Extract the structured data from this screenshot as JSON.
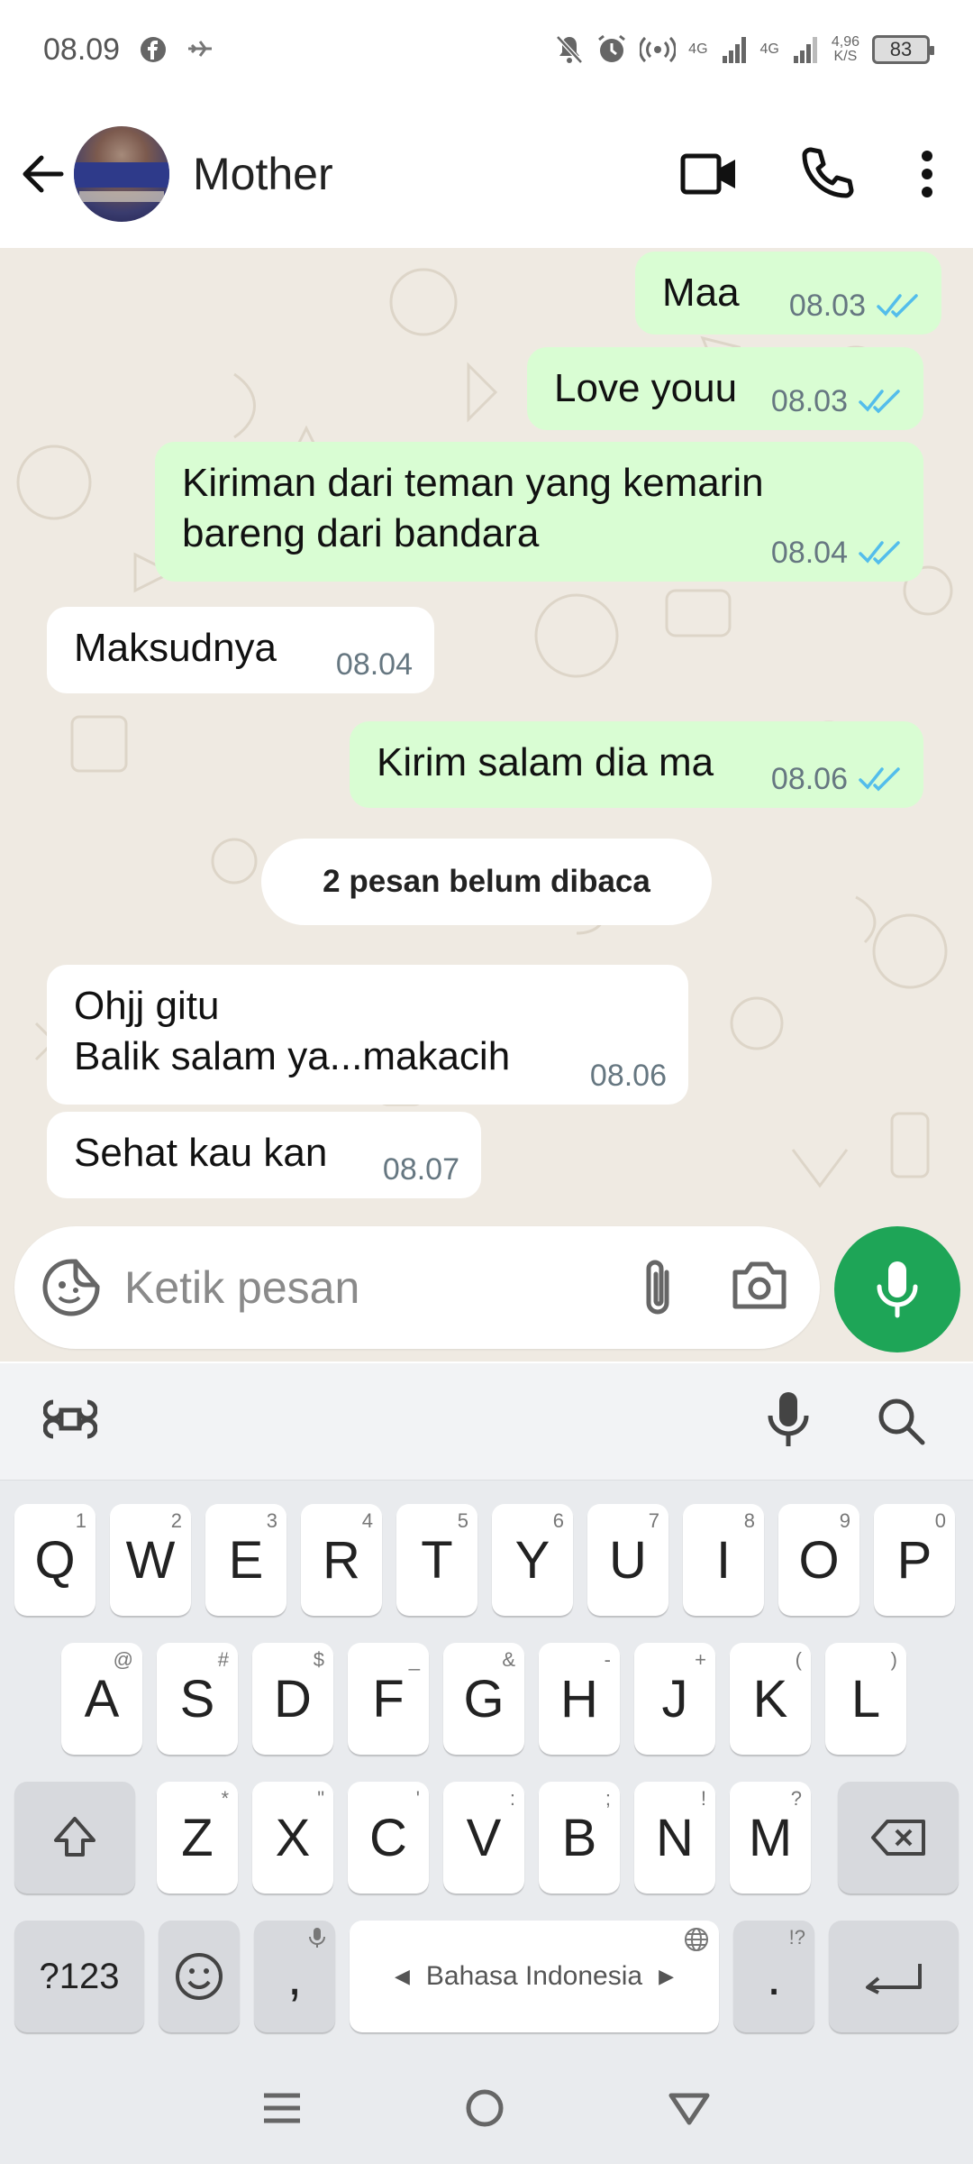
{
  "status": {
    "time": "08.09",
    "net1": "4G",
    "net2": "4G",
    "speed": "4,96",
    "speed_unit": "K/S",
    "battery": "83"
  },
  "header": {
    "contact_name": "Mother"
  },
  "messages": [
    {
      "text": "Maa",
      "time": "08.03",
      "dir": "out"
    },
    {
      "text": "Love youu",
      "time": "08.03",
      "dir": "out"
    },
    {
      "text_lines": [
        "Kiriman dari teman yang kemarin",
        "bareng dari bandara"
      ],
      "time": "08.04",
      "dir": "out"
    },
    {
      "text": "Maksudnya",
      "time": "08.04",
      "dir": "in"
    },
    {
      "text": "Kirim salam dia ma",
      "time": "08.06",
      "dir": "out"
    },
    {
      "text_lines": [
        "Ohjj gitu",
        "Balik salam ya...makacih"
      ],
      "time": "08.06",
      "dir": "in"
    },
    {
      "text": "Sehat kau kan",
      "time": "08.07",
      "dir": "in"
    }
  ],
  "unread_divider": "2 pesan belum dibaca",
  "composer": {
    "placeholder": "Ketik pesan"
  },
  "keyboard": {
    "row1": [
      [
        "Q",
        "1"
      ],
      [
        "W",
        "2"
      ],
      [
        "E",
        "3"
      ],
      [
        "R",
        "4"
      ],
      [
        "T",
        "5"
      ],
      [
        "Y",
        "6"
      ],
      [
        "U",
        "7"
      ],
      [
        "I",
        "8"
      ],
      [
        "O",
        "9"
      ],
      [
        "P",
        "0"
      ]
    ],
    "row2": [
      [
        "A",
        "@"
      ],
      [
        "S",
        "#"
      ],
      [
        "D",
        "$"
      ],
      [
        "F",
        "_"
      ],
      [
        "G",
        "&"
      ],
      [
        "H",
        "-"
      ],
      [
        "J",
        "+"
      ],
      [
        "K",
        "("
      ],
      [
        "L",
        ")"
      ]
    ],
    "row3": [
      [
        "Z",
        "*"
      ],
      [
        "X",
        "\""
      ],
      [
        "C",
        "'"
      ],
      [
        "V",
        ":"
      ],
      [
        "B",
        ";"
      ],
      [
        "N",
        "!"
      ],
      [
        "M",
        "?"
      ]
    ],
    "sym_key": "?123",
    "comma": ",",
    "period": ".",
    "period_hint": "!?",
    "space_label": "Bahasa Indonesia"
  },
  "colors": {
    "accent_green": "#1ea557",
    "outgoing_bubble": "#d9fdd3",
    "tick_blue": "#53bdeb"
  }
}
